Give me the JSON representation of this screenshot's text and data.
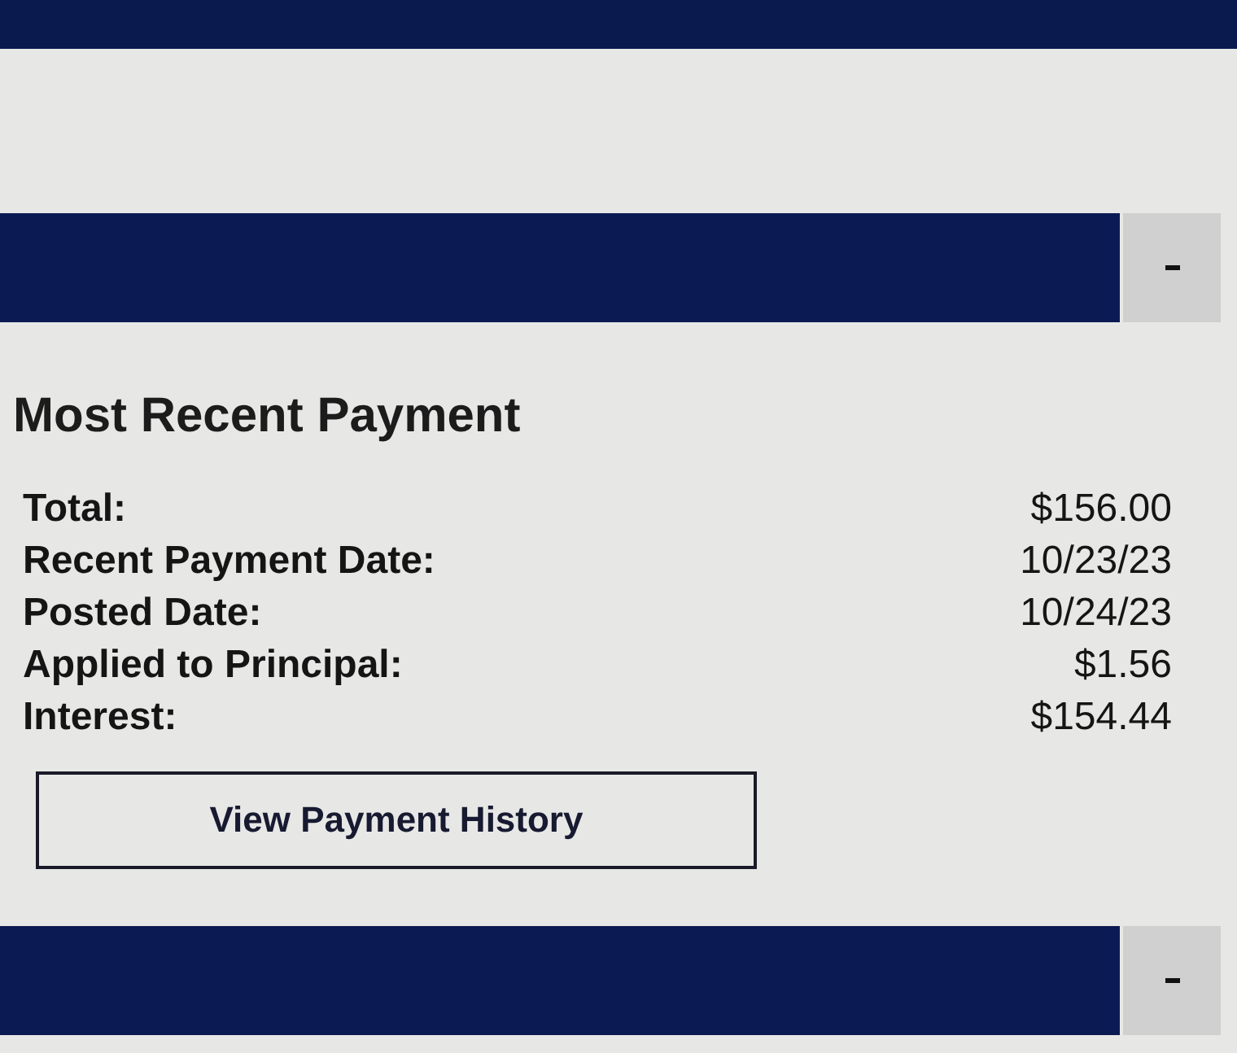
{
  "sections": [
    {
      "expanded": true,
      "content": {
        "title": "Most Recent Payment",
        "rows": [
          {
            "label": "Total:",
            "value": "$156.00"
          },
          {
            "label": "Recent Payment Date:",
            "value": "10/23/23"
          },
          {
            "label": "Posted Date:",
            "value": "10/24/23"
          },
          {
            "label": "Applied to Principal:",
            "value": "$1.56"
          },
          {
            "label": "Interest:",
            "value": "$154.44"
          }
        ],
        "button": "View Payment History"
      }
    },
    {
      "expanded": true
    }
  ]
}
